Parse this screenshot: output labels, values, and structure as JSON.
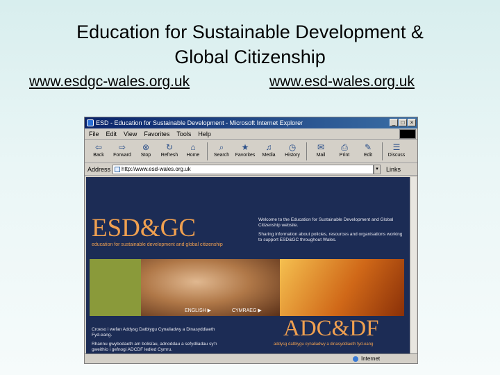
{
  "slide": {
    "title_line1": "Education for Sustainable Development &",
    "title_line2": "Global Citizenship",
    "link_left": "www.esdgc-wales.org.uk",
    "link_right": "www.esd-wales.org.uk"
  },
  "browser": {
    "title": "ESD - Education for Sustainable Development - Microsoft Internet Explorer",
    "menu": [
      "File",
      "Edit",
      "View",
      "Favorites",
      "Tools",
      "Help"
    ],
    "toolbar": [
      {
        "label": "Back",
        "icon": "back-arrow-icon"
      },
      {
        "label": "Forward",
        "icon": "forward-arrow-icon"
      },
      {
        "label": "Stop",
        "icon": "stop-icon"
      },
      {
        "label": "Refresh",
        "icon": "refresh-icon"
      },
      {
        "label": "Home",
        "icon": "home-icon"
      },
      {
        "label": "Search",
        "icon": "search-icon"
      },
      {
        "label": "Favorites",
        "icon": "favorites-icon"
      },
      {
        "label": "Media",
        "icon": "media-icon"
      },
      {
        "label": "History",
        "icon": "history-icon"
      },
      {
        "label": "Mail",
        "icon": "mail-icon"
      },
      {
        "label": "Print",
        "icon": "print-icon"
      },
      {
        "label": "Edit",
        "icon": "edit-icon"
      },
      {
        "label": "Discuss",
        "icon": "discuss-icon"
      }
    ],
    "address_label": "Address",
    "address_value": "http://www.esd-wales.org.uk",
    "links_label": "Links",
    "status_zone": "Internet"
  },
  "site": {
    "logo": "ESD&GC",
    "tagline": "education for sustainable development and global citizenship",
    "welcome_1": "Welcome to the Education for Sustainable Development and Global Citizenship website.",
    "welcome_2": "Sharing information about policies, resources and organisations working to support ESD&GC throughout Wales.",
    "lang_english": "ENGLISH ▶",
    "lang_cymraeg": "CYMRAEG ▶",
    "welsh_1": "Croeso i wefan Addysg Datblygu Cynaliadwy a Dinasyddiaeth Fyd-eang.",
    "welsh_2": "Rhannu gwybodaeth am bolisïau, adnoddau a sefydliadau sy'n gweithio i gefnogi ADCDF ledled Cymru.",
    "welsh_logo": "ADC&DF",
    "welsh_tagline": "addysg datblygu cynaliadwy a dinasyddiaeth fyd-eang"
  }
}
